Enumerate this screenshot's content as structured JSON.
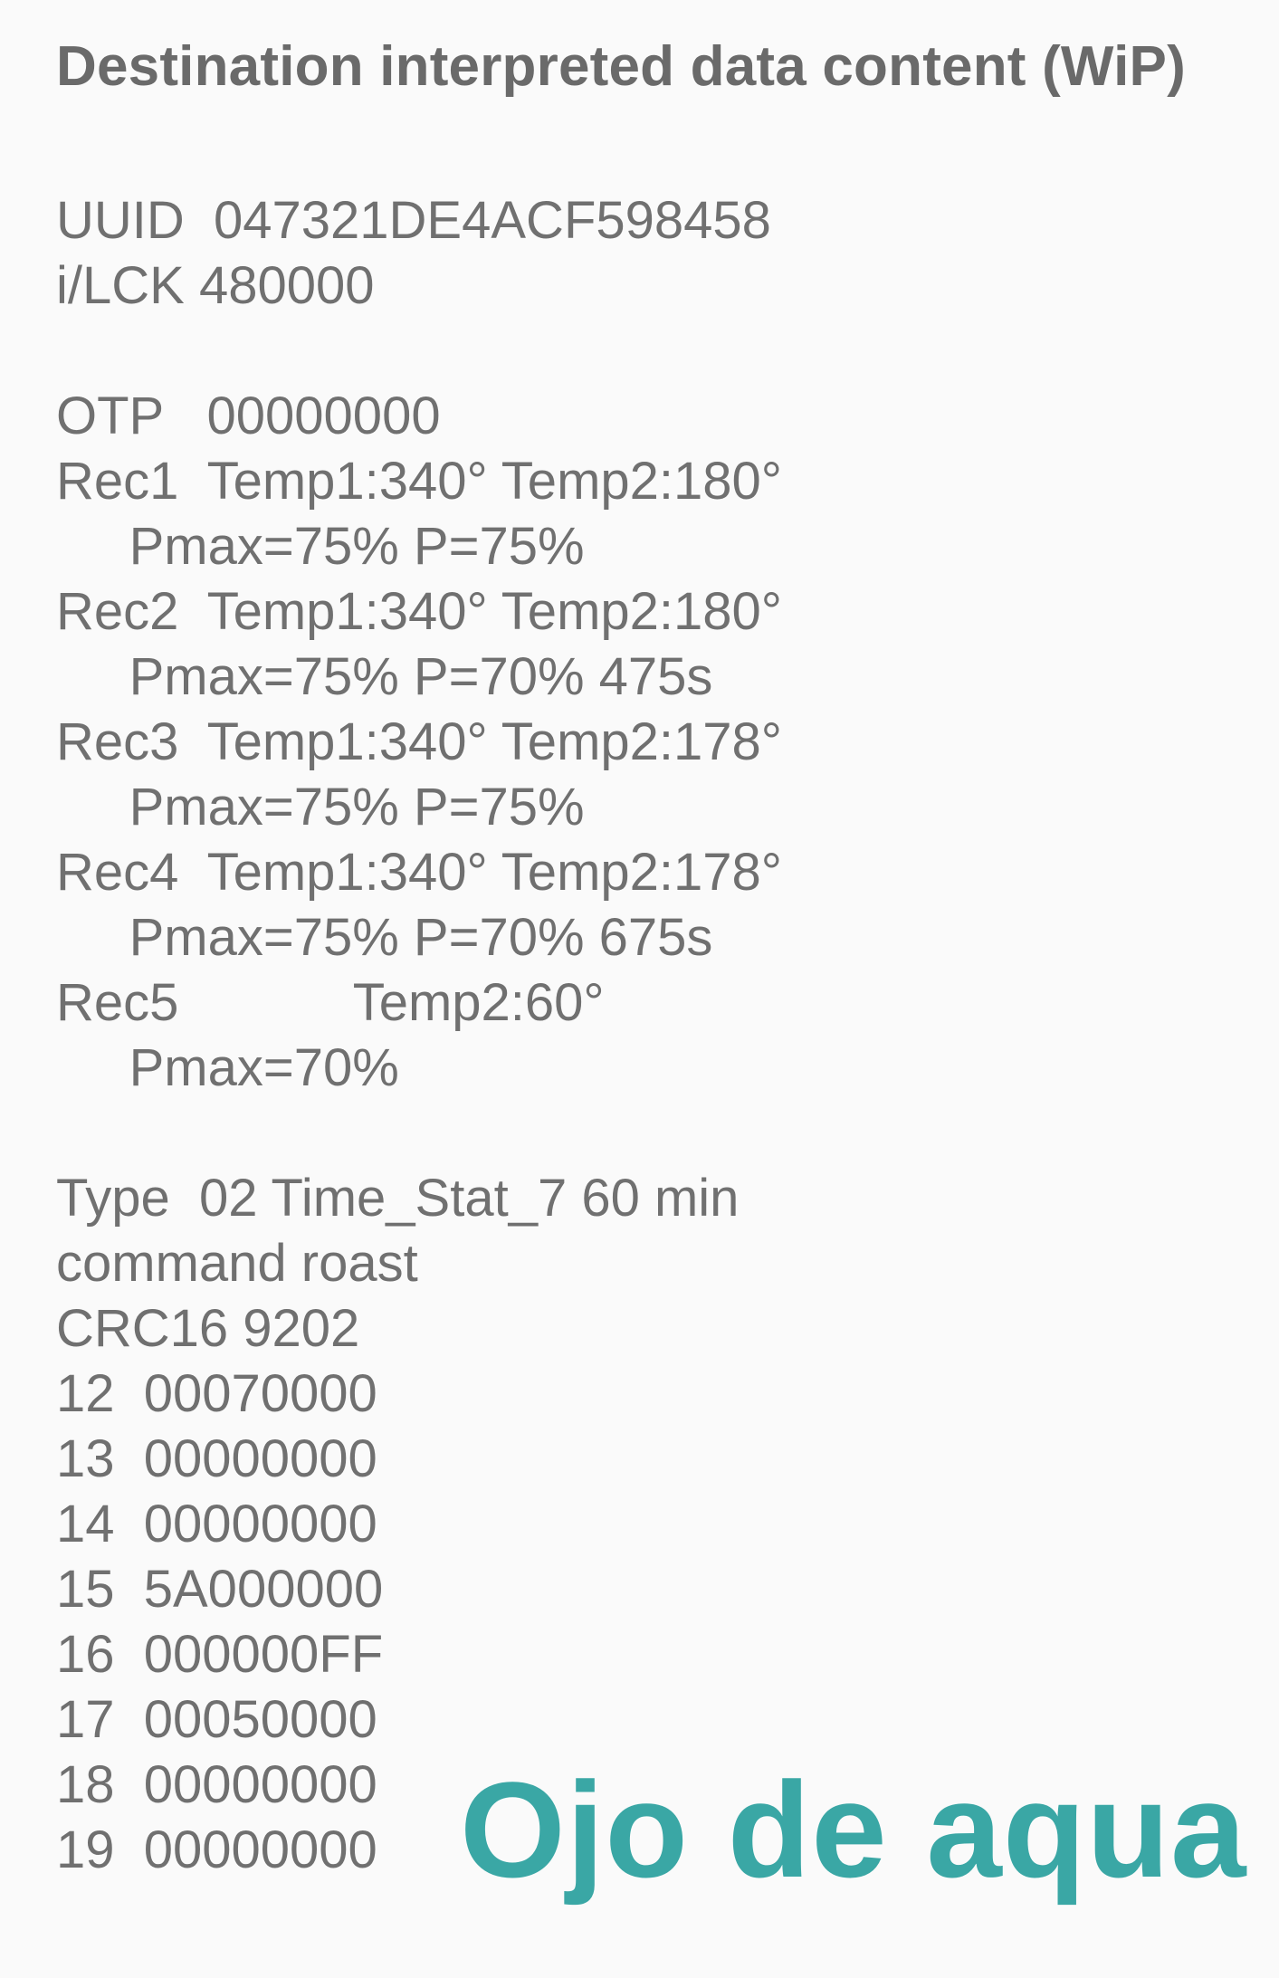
{
  "title": "Destination interpreted data content (WiP)",
  "lines": [
    "UUID  047321DE4ACF598458",
    "i/LCK 480000",
    "OTP   00000000",
    "Rec1  Temp1:340° Temp2:180°",
    "     Pmax=75% P=75%",
    "Rec2  Temp1:340° Temp2:180°",
    "     Pmax=75% P=70% 475s",
    "Rec3  Temp1:340° Temp2:178°",
    "     Pmax=75% P=75%",
    "Rec4  Temp1:340° Temp2:178°",
    "     Pmax=75% P=70% 675s",
    "Rec5            Temp2:60°",
    "     Pmax=70%",
    "Type  02 Time_Stat_7 60 min",
    "command roast",
    "CRC16 9202",
    "12  00070000",
    "13  00000000",
    "14  00000000",
    "15  5A000000",
    "16  000000FF",
    "17  00050000",
    "18  00000000",
    "19  00000000"
  ],
  "watermark": "Ojo de aqua",
  "colors": {
    "background": "#fafafa",
    "text": "#707070",
    "watermark": "#3aa7a5"
  }
}
